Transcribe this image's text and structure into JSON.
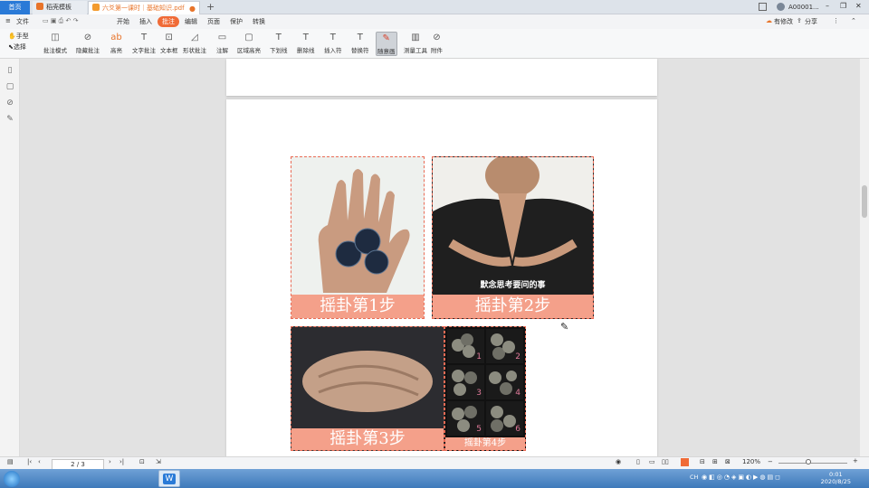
{
  "tabs": {
    "home": "首页",
    "template": "稻壳模板",
    "document": "六爻第一课时｜基础知识.pdf",
    "close": "●",
    "add": "+"
  },
  "window": {
    "user": "A00001...",
    "controls": [
      "–",
      "❐",
      "✕"
    ]
  },
  "menu": {
    "file": "文件",
    "items": [
      "开始",
      "插入",
      "批注",
      "编辑",
      "页面",
      "保护",
      "转换"
    ],
    "active": "批注",
    "right": [
      "有修改",
      "分享"
    ]
  },
  "toolbar": {
    "hand": "手型",
    "select": "选择",
    "items": [
      "批注模式",
      "隐藏批注",
      "高亮",
      "文字批注",
      "文本框",
      "形状批注",
      "注解",
      "区域高亮",
      "下划线",
      "删除线",
      "插入符",
      "替换符",
      "随意画",
      "测量工具",
      "附件"
    ]
  },
  "document": {
    "panels": [
      {
        "caption": "摇卦第1步",
        "overlay": ""
      },
      {
        "caption": "摇卦第2步",
        "overlay": "默念思考要问的事"
      },
      {
        "caption": "摇卦第3步",
        "overlay": ""
      },
      {
        "caption": "摇卦第4步",
        "overlay": ""
      }
    ],
    "grid_numbers": [
      "1",
      "2",
      "3",
      "4",
      "5",
      "6"
    ]
  },
  "status": {
    "page": "2 / 3",
    "zoom": "120%"
  },
  "taskbar": {
    "time": "0:01",
    "date": "2020/8/25",
    "lang": "CH",
    "wps": "W"
  },
  "colors": {
    "accent": "#f06b37",
    "caption_bg": "#f4a08a",
    "tab_blue": "#2a7ad7"
  }
}
